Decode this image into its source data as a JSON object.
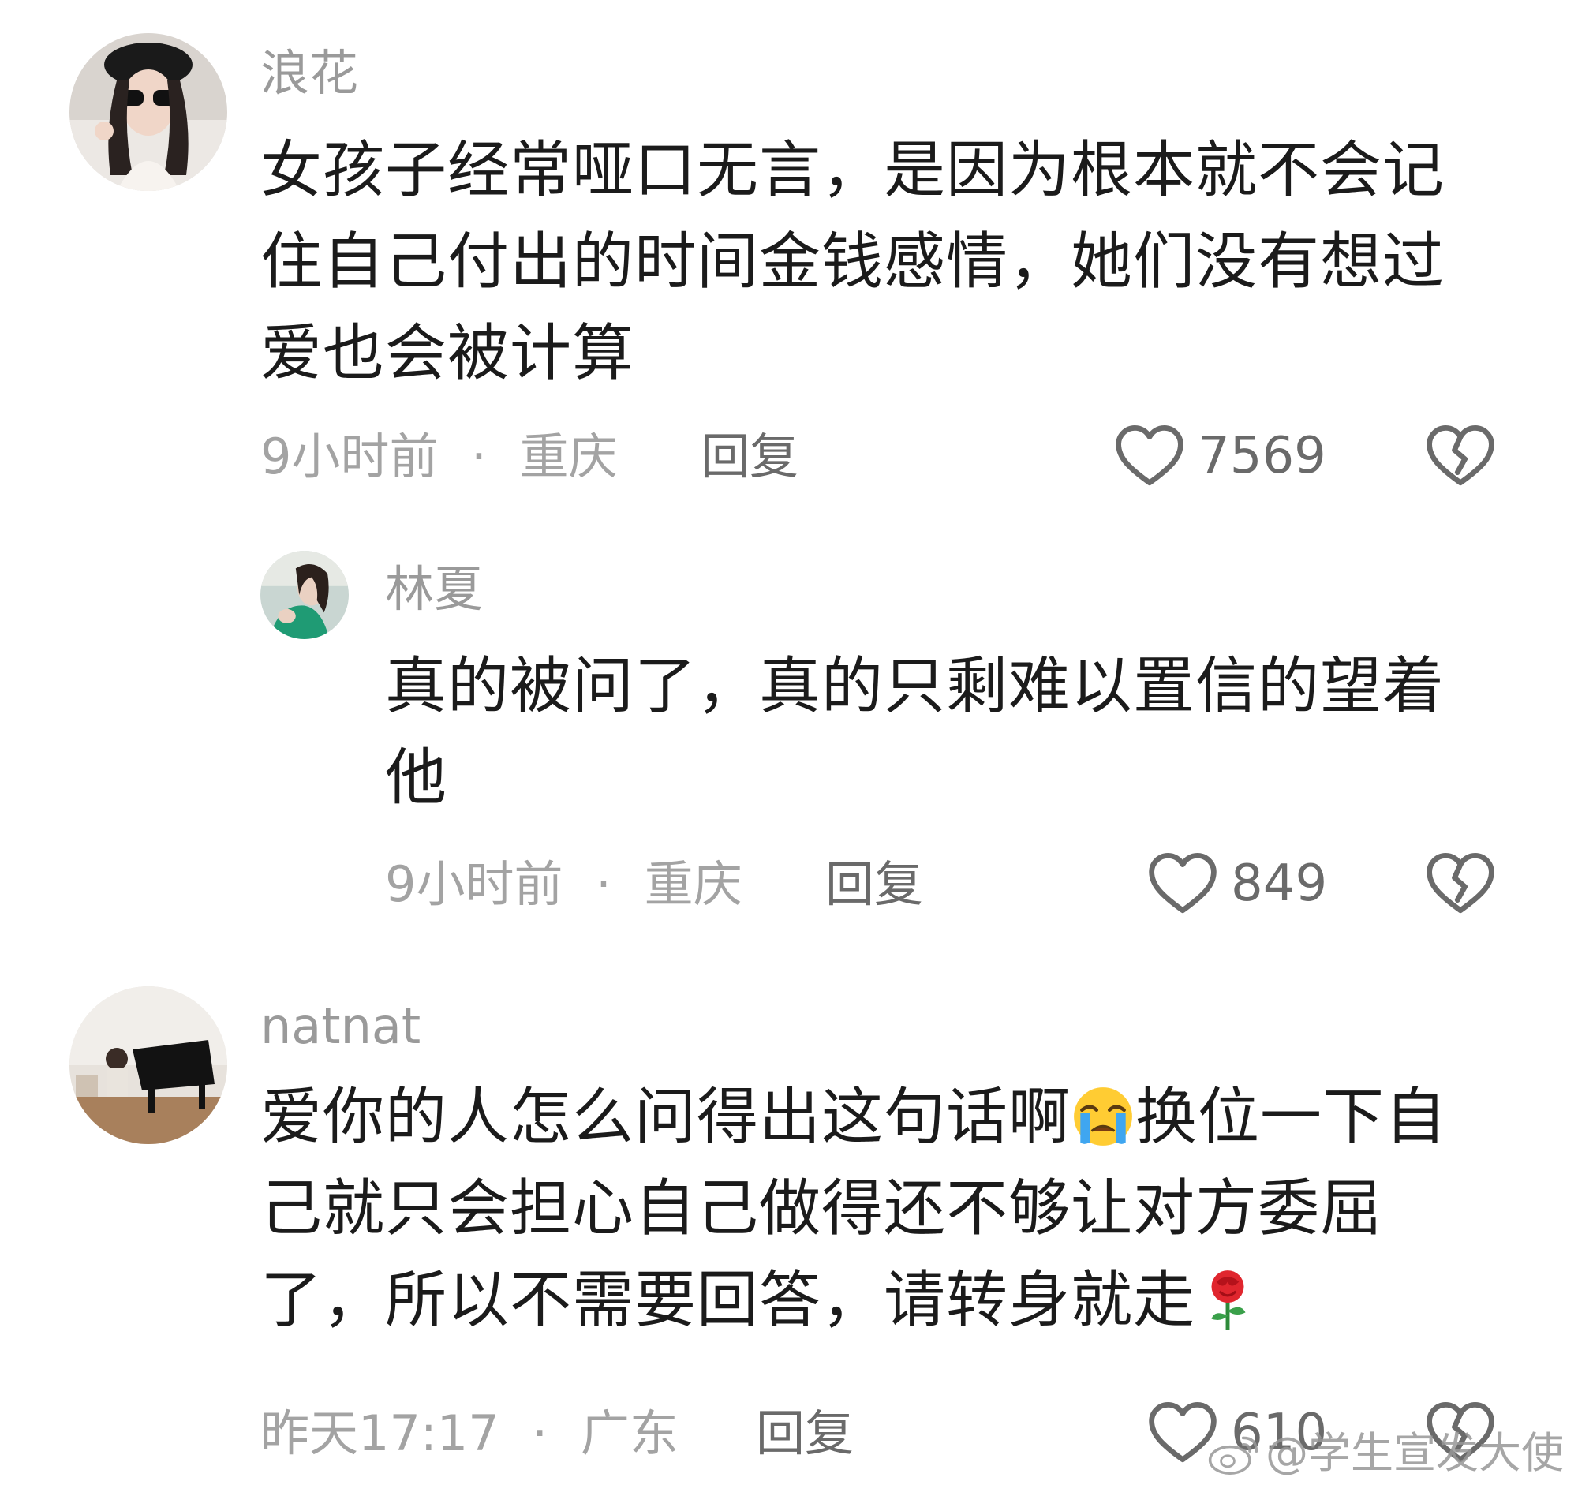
{
  "comments": [
    {
      "username": "浪花",
      "text": "女孩子经常哑口无言，是因为根本就不会记住自己付出的时间金钱感情，她们没有想过爱也会被计算",
      "time": "9小时前",
      "location": "重庆",
      "separator": "·",
      "reply_label": "回复",
      "likes": "7569"
    },
    {
      "username": "林夏",
      "text": "真的被问了，真的只剩难以置信的望着他",
      "time": "9小时前",
      "location": "重庆",
      "separator": "·",
      "reply_label": "回复",
      "likes": "849"
    },
    {
      "username": "natnat",
      "text_part1": "爱你的人怎么问得出这句话啊",
      "text_part2": "换位一下自己就只会担心自己做得还不够让对方委屈了，所以不需要回答，请转身就走",
      "emoji_1": "loudly-crying-face",
      "emoji_2": "rose",
      "time": "昨天17:17",
      "location": "广东",
      "separator": "·",
      "reply_label": "回复",
      "likes": "610"
    }
  ],
  "watermark": "@学生宣发大使",
  "colors": {
    "background": "#ffffff",
    "username": "#9a9a9a",
    "body": "#1b1b1b",
    "meta": "#a3a3a3",
    "action": "#6a6a6a"
  }
}
